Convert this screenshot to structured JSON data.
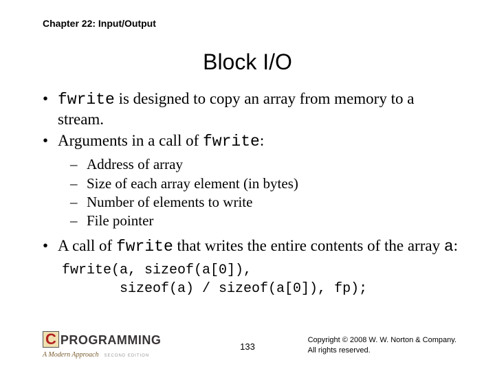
{
  "chapter": "Chapter 22: Input/Output",
  "title": "Block I/O",
  "bullets": [
    {
      "pre": "",
      "code": "fwrite",
      "post": " is designed to copy an array from memory to a stream."
    },
    {
      "pre": "Arguments in a call of ",
      "code": "fwrite",
      "post": ":"
    }
  ],
  "sub": [
    "Address of array",
    "Size of each array element (in bytes)",
    "Number of elements to write",
    "File pointer"
  ],
  "bullet3": {
    "pre": "A call of ",
    "code": "fwrite",
    "post": " that writes the entire contents of the array ",
    "code2": "a",
    "post2": ":"
  },
  "code_lines": [
    "fwrite(a, sizeof(a[0]),",
    "       sizeof(a) / sizeof(a[0]), fp);"
  ],
  "logo": {
    "c": "C",
    "text": "PROGRAMMING",
    "sub": "A Modern Approach",
    "ed": "SECOND EDITION"
  },
  "page": "133",
  "copyright": {
    "l1": "Copyright © 2008 W. W. Norton & Company.",
    "l2": "All rights reserved."
  }
}
